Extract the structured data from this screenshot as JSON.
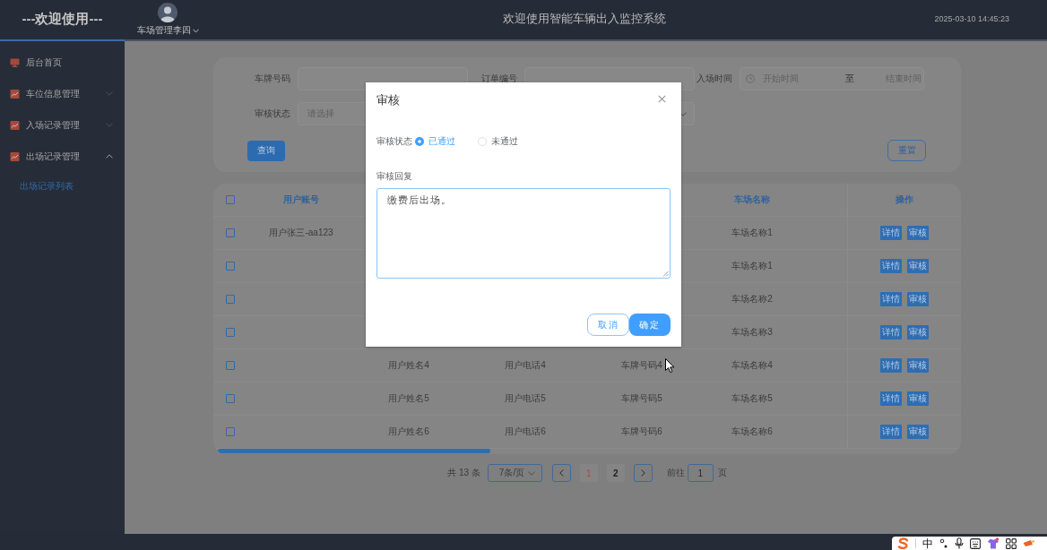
{
  "header": {
    "brand": "---欢迎使用---",
    "user_name": "车场管理李四",
    "title": "欢迎使用智能车辆出入监控系统",
    "datetime": "2025-03-10 14:45:23"
  },
  "sidebar": {
    "items": [
      {
        "kind": "page",
        "label": "后台首页"
      },
      {
        "kind": "group",
        "label": "车位信息管理",
        "expanded": false
      },
      {
        "kind": "group",
        "label": "入场记录管理",
        "expanded": false
      },
      {
        "kind": "group",
        "label": "出场记录管理",
        "expanded": true,
        "children": [
          {
            "label": "出场记录列表",
            "selected": true
          }
        ]
      }
    ]
  },
  "filters": {
    "rows": [
      [
        {
          "kind": "text",
          "label": "车牌号码"
        },
        {
          "kind": "text",
          "label": "订单编号"
        },
        {
          "kind": "date_range",
          "label": "入场时间",
          "start_placeholder": "开始时间",
          "separator": "至",
          "end_placeholder": "结束时间"
        }
      ],
      [
        {
          "kind": "select",
          "label": "审核状态",
          "placeholder": "请选择"
        },
        {
          "kind": "select"
        }
      ]
    ],
    "buttons": [
      {
        "kind": "primary",
        "label": "查询"
      },
      {
        "kind": "outline",
        "label": "重置"
      }
    ]
  },
  "table": {
    "select_all": {
      "checked": false
    },
    "columns": [
      "用户账号",
      null,
      null,
      null,
      "车场名称",
      "操作"
    ],
    "rows": [
      {
        "selected": false,
        "cells": [
          "用户张三-aa123",
          null,
          null,
          null,
          "车场名称1"
        ],
        "actions": [
          "详情",
          "审核"
        ]
      },
      {
        "selected": false,
        "cells": [
          null,
          null,
          null,
          null,
          "车场名称1"
        ],
        "actions": [
          "详情",
          "审核"
        ]
      },
      {
        "selected": false,
        "cells": [
          null,
          null,
          null,
          null,
          "车场名称2"
        ],
        "actions": [
          "详情",
          "审核"
        ]
      },
      {
        "selected": false,
        "cells": [
          null,
          null,
          null,
          null,
          "车场名称3"
        ],
        "actions": [
          "详情",
          "审核"
        ]
      },
      {
        "selected": false,
        "cells": [
          null,
          "用户姓名4",
          "用户电话4",
          "车牌号码4",
          "车场名称4"
        ],
        "actions": [
          "详情",
          "审核"
        ]
      },
      {
        "selected": false,
        "cells": [
          null,
          "用户姓名5",
          "用户电话5",
          "车牌号码5",
          "车场名称5"
        ],
        "actions": [
          "详情",
          "审核"
        ]
      },
      {
        "selected": false,
        "cells": [
          null,
          "用户姓名6",
          "用户电话6",
          "车牌号码6",
          "车场名称6"
        ],
        "actions": [
          "详情",
          "审核"
        ]
      }
    ]
  },
  "pagination": {
    "total": "共 13 条",
    "page_size": "7条/页",
    "pages": [
      {
        "label": "1",
        "selected": true
      },
      {
        "label": "2",
        "selected": false
      }
    ],
    "jump_label": "前往",
    "jump_value": "1",
    "jump_suffix": "页"
  },
  "dialog": {
    "title": "审核",
    "status_label": "审核状态",
    "status_options": [
      {
        "label": "已通过",
        "selected": true
      },
      {
        "label": "未通过",
        "selected": false
      }
    ],
    "reply_label": "审核回复",
    "reply_value": "缴费后出场。",
    "buttons": [
      {
        "kind": "secondary",
        "label": "取消"
      },
      {
        "kind": "primary",
        "label": "确定"
      }
    ]
  },
  "ime_toolbar": {
    "mode": "中"
  }
}
